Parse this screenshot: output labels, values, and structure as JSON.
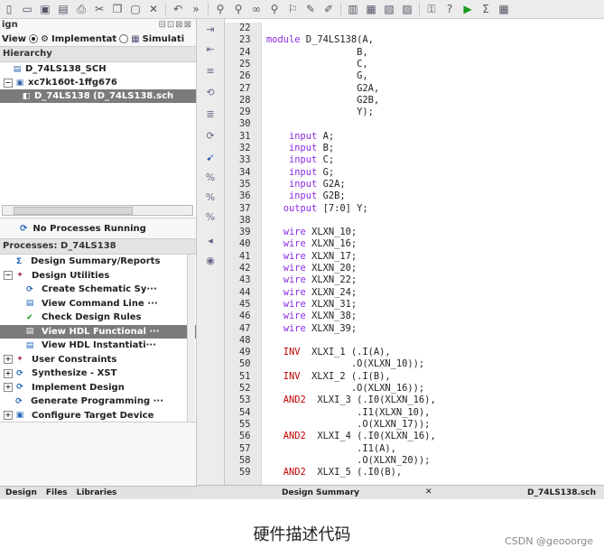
{
  "toolbar": {
    "icons": [
      "new-icon",
      "open-icon",
      "save-icon",
      "save-all-icon",
      "print-icon",
      "cut-icon",
      "copy-icon",
      "paste-icon",
      "delete-icon",
      "undo-icon",
      "more-icon",
      "find-icon",
      "find-next-icon",
      "binoculars-icon",
      "find-in-files-icon",
      "bookmark-icon",
      "highlight-icon",
      "pencil-icon",
      "window-icon",
      "tile-icon",
      "cascade-icon",
      "layout-icon",
      "key-icon",
      "help-icon",
      "run-icon",
      "sigma-icon",
      "summary-icon"
    ]
  },
  "design_panel": {
    "title": "ign",
    "view_label": "View",
    "view_impl": "Implementat",
    "view_sim": "Simulati",
    "hierarchy_label": "Hierarchy",
    "tree": [
      {
        "label": "D_74LS138_SCH",
        "indent": 1,
        "icon": "project-icon"
      },
      {
        "label": "xc7k160t-1ffg676",
        "indent": 0,
        "icon": "chip-icon",
        "expander": "⊟"
      },
      {
        "label": "D_74LS138 (D_74LS138.sch",
        "indent": 2,
        "icon": "schematic-icon",
        "selected": true
      }
    ]
  },
  "process_panel": {
    "status": "No Processes Running",
    "title": "Processes: D_74LS138",
    "items": [
      {
        "label": "Design Summary/Reports",
        "indent": 1,
        "expander": "",
        "icon": "sigma-icon"
      },
      {
        "label": "Design Utilities",
        "indent": 0,
        "expander": "⊟",
        "icon": "utilities-icon"
      },
      {
        "label": "Create Schematic Sy···",
        "indent": 2,
        "icon": "process-icon"
      },
      {
        "label": "View Command Line ···",
        "indent": 2,
        "icon": "doc-icon"
      },
      {
        "label": "Check Design Rules",
        "indent": 2,
        "icon": "check-icon"
      },
      {
        "label": "View HDL Functional ···",
        "indent": 2,
        "icon": "doc-icon",
        "selected": true
      },
      {
        "label": "View HDL Instantiati···",
        "indent": 2,
        "icon": "doc-icon"
      },
      {
        "label": "User Constraints",
        "indent": 0,
        "expander": "⊞",
        "icon": "constraints-icon"
      },
      {
        "label": "Synthesize - XST",
        "indent": 0,
        "expander": "⊞",
        "icon": "process-icon"
      },
      {
        "label": "Implement Design",
        "indent": 0,
        "expander": "⊞",
        "icon": "process-icon"
      },
      {
        "label": "Generate Programming ···",
        "indent": 1,
        "icon": "process-icon"
      },
      {
        "label": "Configure Target Device",
        "indent": 0,
        "expander": "⊞",
        "icon": "device-icon"
      }
    ]
  },
  "left_tabs": [
    "Design",
    "Files",
    "Libraries"
  ],
  "editor": {
    "lines": [
      {
        "n": "22",
        "t": ""
      },
      {
        "n": "23",
        "t": "module D_74LS138(A,",
        "k": [
          [
            "module",
            "kw"
          ]
        ]
      },
      {
        "n": "24",
        "t": "                B,"
      },
      {
        "n": "25",
        "t": "                C,"
      },
      {
        "n": "26",
        "t": "                G,"
      },
      {
        "n": "27",
        "t": "                G2A,"
      },
      {
        "n": "28",
        "t": "                G2B,"
      },
      {
        "n": "29",
        "t": "                Y);"
      },
      {
        "n": "30",
        "t": ""
      },
      {
        "n": "31",
        "t": "    input A;",
        "k": [
          [
            "input",
            "kw"
          ]
        ]
      },
      {
        "n": "32",
        "t": "    input B;",
        "k": [
          [
            "input",
            "kw"
          ]
        ]
      },
      {
        "n": "33",
        "t": "    input C;",
        "k": [
          [
            "input",
            "kw"
          ]
        ]
      },
      {
        "n": "34",
        "t": "    input G;",
        "k": [
          [
            "input",
            "kw"
          ]
        ]
      },
      {
        "n": "35",
        "t": "    input G2A;",
        "k": [
          [
            "input",
            "kw"
          ]
        ]
      },
      {
        "n": "36",
        "t": "    input G2B;",
        "k": [
          [
            "input",
            "kw"
          ]
        ]
      },
      {
        "n": "37",
        "t": "   output [7:0] Y;",
        "k": [
          [
            "output",
            "kw"
          ]
        ]
      },
      {
        "n": "38",
        "t": ""
      },
      {
        "n": "39",
        "t": "   wire XLXN_10;",
        "k": [
          [
            "wire",
            "kw"
          ]
        ]
      },
      {
        "n": "40",
        "t": "   wire XLXN_16;",
        "k": [
          [
            "wire",
            "kw"
          ]
        ]
      },
      {
        "n": "41",
        "t": "   wire XLXN_17;",
        "k": [
          [
            "wire",
            "kw"
          ]
        ]
      },
      {
        "n": "42",
        "t": "   wire XLXN_20;",
        "k": [
          [
            "wire",
            "kw"
          ]
        ]
      },
      {
        "n": "43",
        "t": "   wire XLXN_22;",
        "k": [
          [
            "wire",
            "kw"
          ]
        ]
      },
      {
        "n": "44",
        "t": "   wire XLXN_24;",
        "k": [
          [
            "wire",
            "kw"
          ]
        ]
      },
      {
        "n": "45",
        "t": "   wire XLXN_31;",
        "k": [
          [
            "wire",
            "kw"
          ]
        ]
      },
      {
        "n": "46",
        "t": "   wire XLXN_38;",
        "k": [
          [
            "wire",
            "kw"
          ]
        ]
      },
      {
        "n": "47",
        "t": "   wire XLXN_39;",
        "k": [
          [
            "wire",
            "kw"
          ]
        ]
      },
      {
        "n": "48",
        "t": ""
      },
      {
        "n": "49",
        "t": "   INV  XLXI_1 (.I(A),",
        "k": [
          [
            "INV",
            "kr"
          ]
        ]
      },
      {
        "n": "50",
        "t": "               .O(XLXN_10));"
      },
      {
        "n": "51",
        "t": "   INV  XLXI_2 (.I(B),",
        "k": [
          [
            "INV",
            "kr"
          ]
        ]
      },
      {
        "n": "52",
        "t": "               .O(XLXN_16));"
      },
      {
        "n": "53",
        "t": "   AND2  XLXI_3 (.I0(XLXN_16),",
        "k": [
          [
            "AND2",
            "kr"
          ]
        ]
      },
      {
        "n": "54",
        "t": "                .I1(XLXN_10),"
      },
      {
        "n": "55",
        "t": "                .O(XLXN_17));"
      },
      {
        "n": "56",
        "t": "   AND2  XLXI_4 (.I0(XLXN_16),",
        "k": [
          [
            "AND2",
            "kr"
          ]
        ]
      },
      {
        "n": "57",
        "t": "                .I1(A),"
      },
      {
        "n": "58",
        "t": "                .O(XLXN_20));"
      },
      {
        "n": "59",
        "t": "   AND2  XLXI_5 (.I0(B),",
        "k": [
          [
            "AND2",
            "kr"
          ]
        ]
      }
    ],
    "bottom_tabs": [
      "Design Summary",
      "D_74LS138.sch"
    ]
  },
  "caption": "硬件描述代码",
  "watermark": "CSDN @geooorge"
}
